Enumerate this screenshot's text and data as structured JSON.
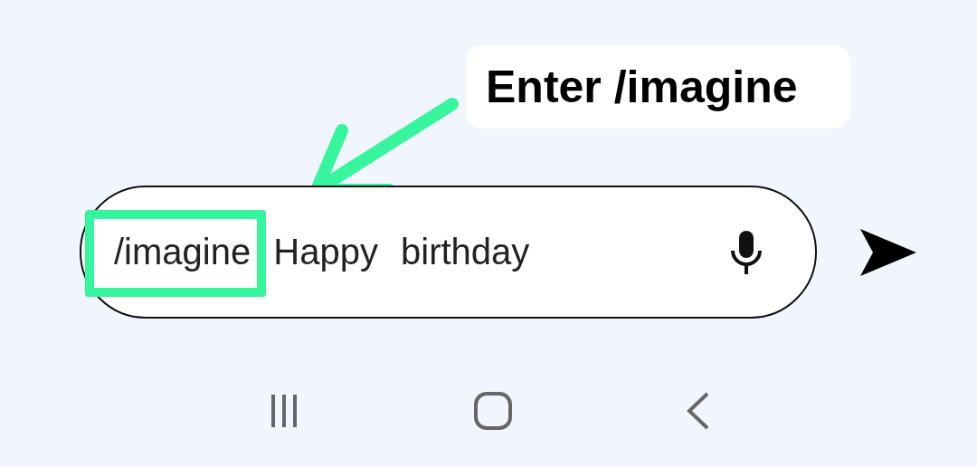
{
  "callout": {
    "text": "Enter /imagine"
  },
  "message_field": {
    "value": "/imagine Happy birthday"
  }
}
